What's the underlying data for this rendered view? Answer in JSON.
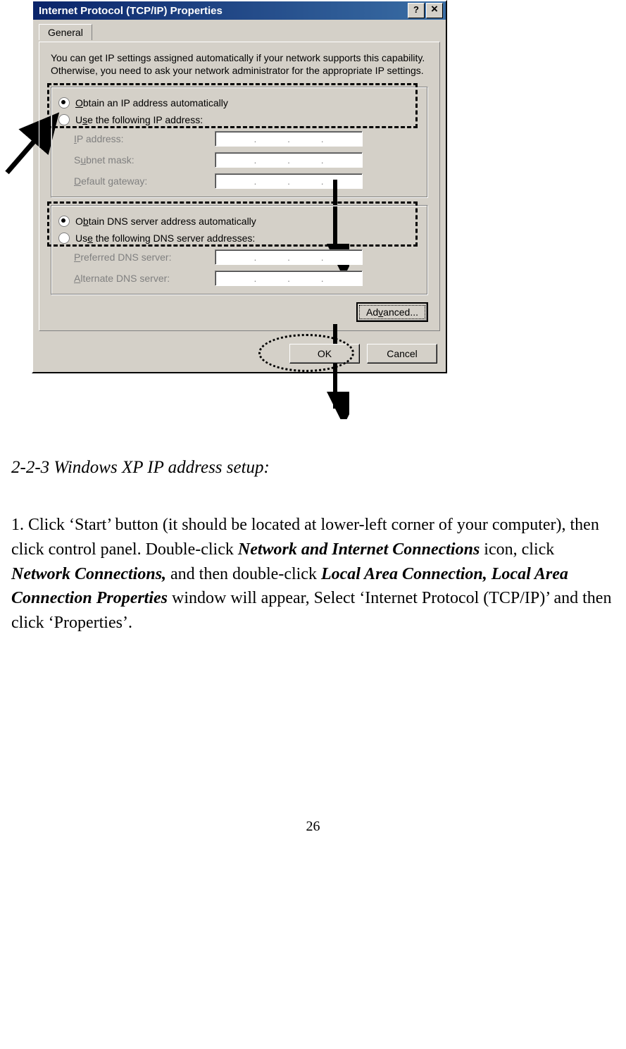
{
  "dialog": {
    "title": "Internet Protocol (TCP/IP) Properties",
    "tab": "General",
    "description": "You can get IP settings assigned automatically if your network supports this capability. Otherwise, you need to ask your network administrator for the appropriate IP settings.",
    "ip_group": {
      "auto_label": "Obtain an IP address automatically",
      "manual_label": "Use the following IP address:",
      "ip_label": "IP address:",
      "mask_label": "Subnet mask:",
      "gw_label": "Default gateway:"
    },
    "dns_group": {
      "auto_label": "Obtain DNS server address automatically",
      "manual_label": "Use the following DNS server addresses:",
      "pref_label": "Preferred DNS server:",
      "alt_label": "Alternate DNS server:"
    },
    "advanced_label": "Advanced...",
    "ok_label": "OK",
    "cancel_label": "Cancel"
  },
  "doc": {
    "heading": "2-2-3 Windows XP IP address setup:",
    "para_prefix": "1. Click ‘Start’ button (it should be located at lower-left corner of your computer), then click control panel. Double-click ",
    "bold1": "Network and Internet Connections",
    "mid1": " icon, click ",
    "bold2": "Network Connections,",
    "mid2": " and then double-click ",
    "bold3": "Local Area Connection, Local Area Connection Properties",
    "suffix": " window will appear, Select ‘Internet Protocol (TCP/IP)’ and then click ‘Properties’.",
    "page_number": "26"
  }
}
